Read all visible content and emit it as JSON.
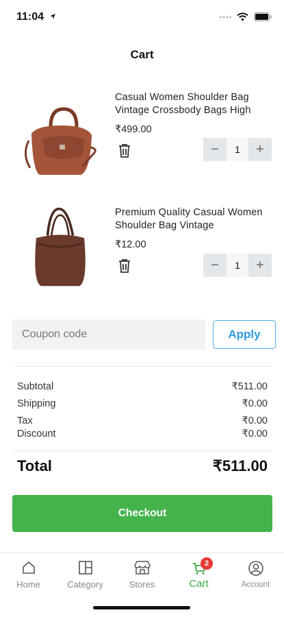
{
  "status_bar": {
    "time": "11:04"
  },
  "page": {
    "title": "Cart"
  },
  "items": [
    {
      "name": "Casual Women Shoulder Bag Vintage Crossbody Bags High",
      "price": "₹499.00",
      "quantity": "1"
    },
    {
      "name": "Premium Quality Casual Women Shoulder Bag Vintage",
      "price": "₹12.00",
      "quantity": "1"
    }
  ],
  "coupon": {
    "placeholder": "Coupon code",
    "apply_label": "Apply"
  },
  "summary": {
    "subtotal_label": "Subtotal",
    "subtotal": "₹511.00",
    "shipping_label": "Shipping",
    "shipping": "₹0.00",
    "tax_label": "Tax",
    "tax": "₹0.00",
    "discount_label": "Discount",
    "discount": "₹0.00",
    "total_label": "Total",
    "total": "₹511.00"
  },
  "checkout": {
    "label": "Checkout"
  },
  "tabbar": {
    "items": [
      {
        "label": "Home",
        "icon": "home-icon"
      },
      {
        "label": "Category",
        "icon": "category-icon"
      },
      {
        "label": "Stores",
        "icon": "store-icon"
      },
      {
        "label": "Cart",
        "icon": "cart-icon",
        "badge": "2",
        "active": true
      },
      {
        "label": "Account",
        "icon": "account-icon"
      }
    ]
  },
  "colors": {
    "accent_green": "#45b34c",
    "apply_blue": "#2a9be0",
    "badge_red": "#e53935"
  }
}
